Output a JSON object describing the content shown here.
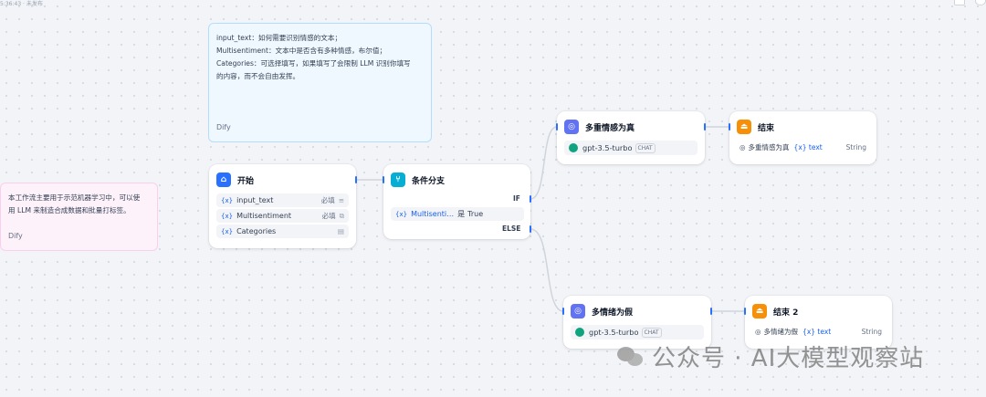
{
  "topbar": {
    "text": "5:36:43 · 未发布"
  },
  "notes": {
    "top": {
      "lines": [
        "input_text：如何需要识别情感的文本；",
        "Multisentiment：文本中是否含有多种情感，布尔值；",
        "Categories：可选择填写，如果填写了会限制 LLM 识别你填写",
        "的内容，而不会自由发挥。"
      ],
      "signature": "Dify"
    },
    "left": {
      "lines": [
        "本工作流主要用于示范机器学习中，可以使",
        "用 LLM 来制造合成数据和批量打标签。"
      ],
      "signature": "Dify"
    }
  },
  "nodes": {
    "start": {
      "title": "开始",
      "vars": [
        {
          "symbol": "{x}",
          "name": "input_text",
          "required": "必填",
          "icon": "text-lines-icon"
        },
        {
          "symbol": "{x}",
          "name": "Multisentiment",
          "required": "必填",
          "icon": "copy-icon"
        },
        {
          "symbol": "{x}",
          "name": "Categories",
          "required": "",
          "icon": "list-icon"
        }
      ]
    },
    "ifelse": {
      "title": "条件分支",
      "if_label": "IF",
      "else_label": "ELSE",
      "condition": {
        "symbol": "{x}",
        "var": "Multisenti…",
        "op": "是",
        "value": "True"
      }
    },
    "llm_true": {
      "title": "多重情感为真",
      "model": "gpt-3.5-turbo",
      "badge": "CHAT"
    },
    "llm_false": {
      "title": "多情绪为假",
      "model": "gpt-3.5-turbo",
      "badge": "CHAT"
    },
    "end1": {
      "title": "结束",
      "source": "多重情感为真",
      "symbol": "{x}",
      "var": "text",
      "type": "String"
    },
    "end2": {
      "title": "结束 2",
      "source": "多情绪为假",
      "symbol": "{x}",
      "var": "text",
      "type": "String"
    }
  },
  "watermark": {
    "text": "公众号 · AI大模型观察站"
  },
  "colors": {
    "accent": "#2970ff",
    "edge": "#d0d5dd",
    "start": "#2970ff",
    "ifelse": "#06aed4",
    "llm": "#6172f3",
    "end": "#f79009"
  }
}
